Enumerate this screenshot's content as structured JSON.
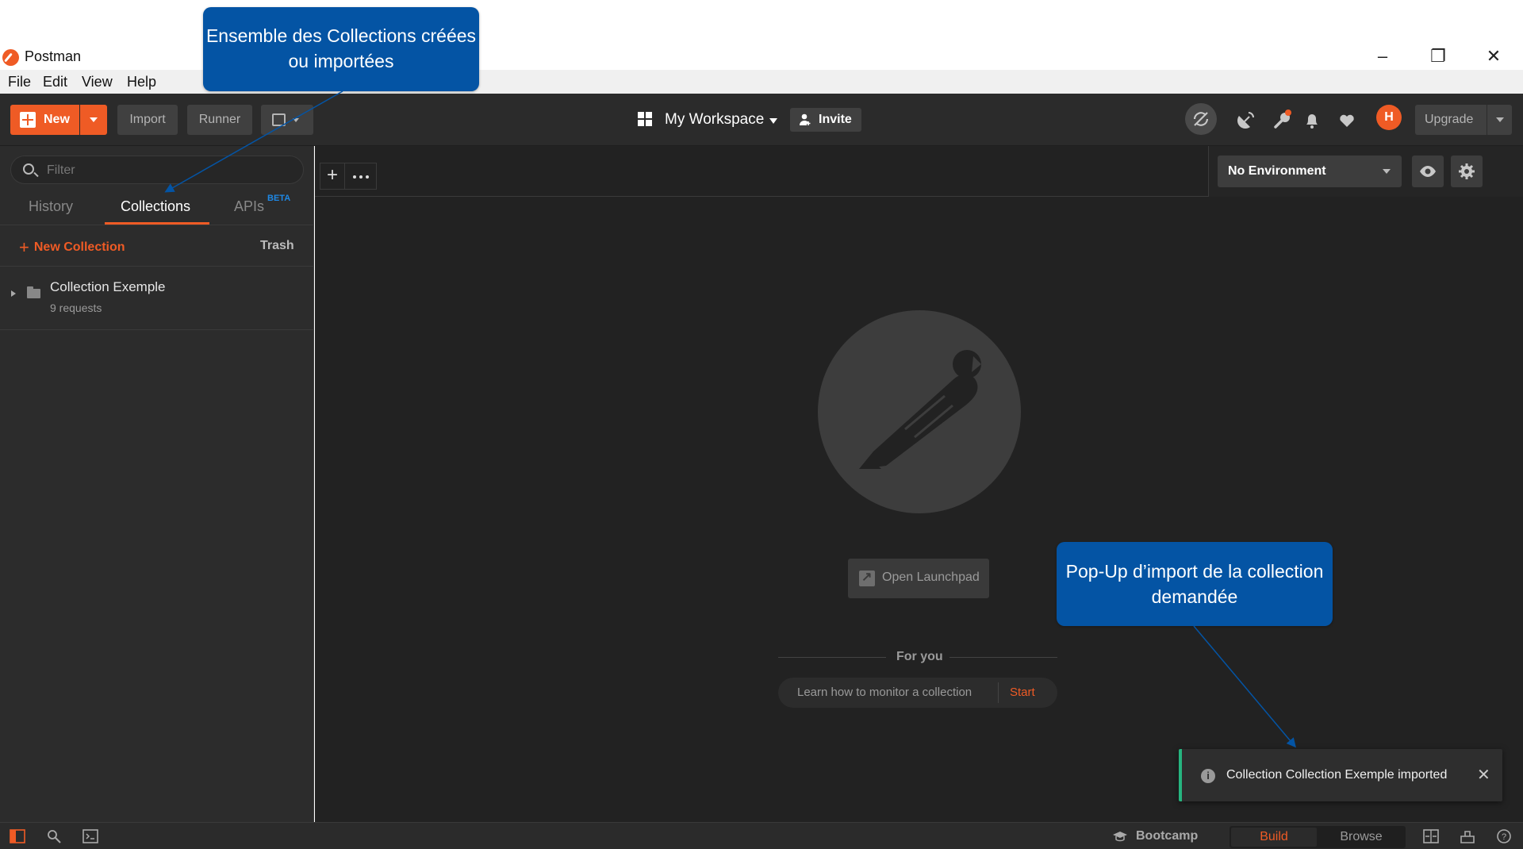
{
  "window": {
    "title": "Postman",
    "menu": [
      "File",
      "Edit",
      "View",
      "Help"
    ]
  },
  "toolbar": {
    "new_label": "New",
    "import_label": "Import",
    "runner_label": "Runner",
    "workspace_label": "My Workspace",
    "invite_label": "Invite",
    "avatar_initial": "H",
    "upgrade_label": "Upgrade"
  },
  "sidebar": {
    "filter_placeholder": "Filter",
    "tabs": [
      {
        "label": "History"
      },
      {
        "label": "Collections"
      },
      {
        "label": "APIs",
        "badge": "BETA"
      }
    ],
    "new_collection_label": "New Collection",
    "trash_label": "Trash",
    "collections": [
      {
        "name": "Collection Exemple",
        "count": "9 requests"
      }
    ]
  },
  "main": {
    "environment": "No Environment",
    "launchpad_label": "Open Launchpad",
    "for_you_label": "For you",
    "tip_text": "Learn how to monitor a collection",
    "tip_action": "Start"
  },
  "toast": {
    "message": "Collection Collection Exemple imported"
  },
  "statusbar": {
    "bootcamp_label": "Bootcamp",
    "build_label": "Build",
    "browse_label": "Browse"
  },
  "annotations": {
    "collections_note": "Ensemble des Collections créées ou importées",
    "popup_note": "Pop-Up d’import de la collection demandée"
  },
  "colors": {
    "accent": "#ef5b25",
    "callout": "#0454a4",
    "toast_border": "#26b47f"
  }
}
